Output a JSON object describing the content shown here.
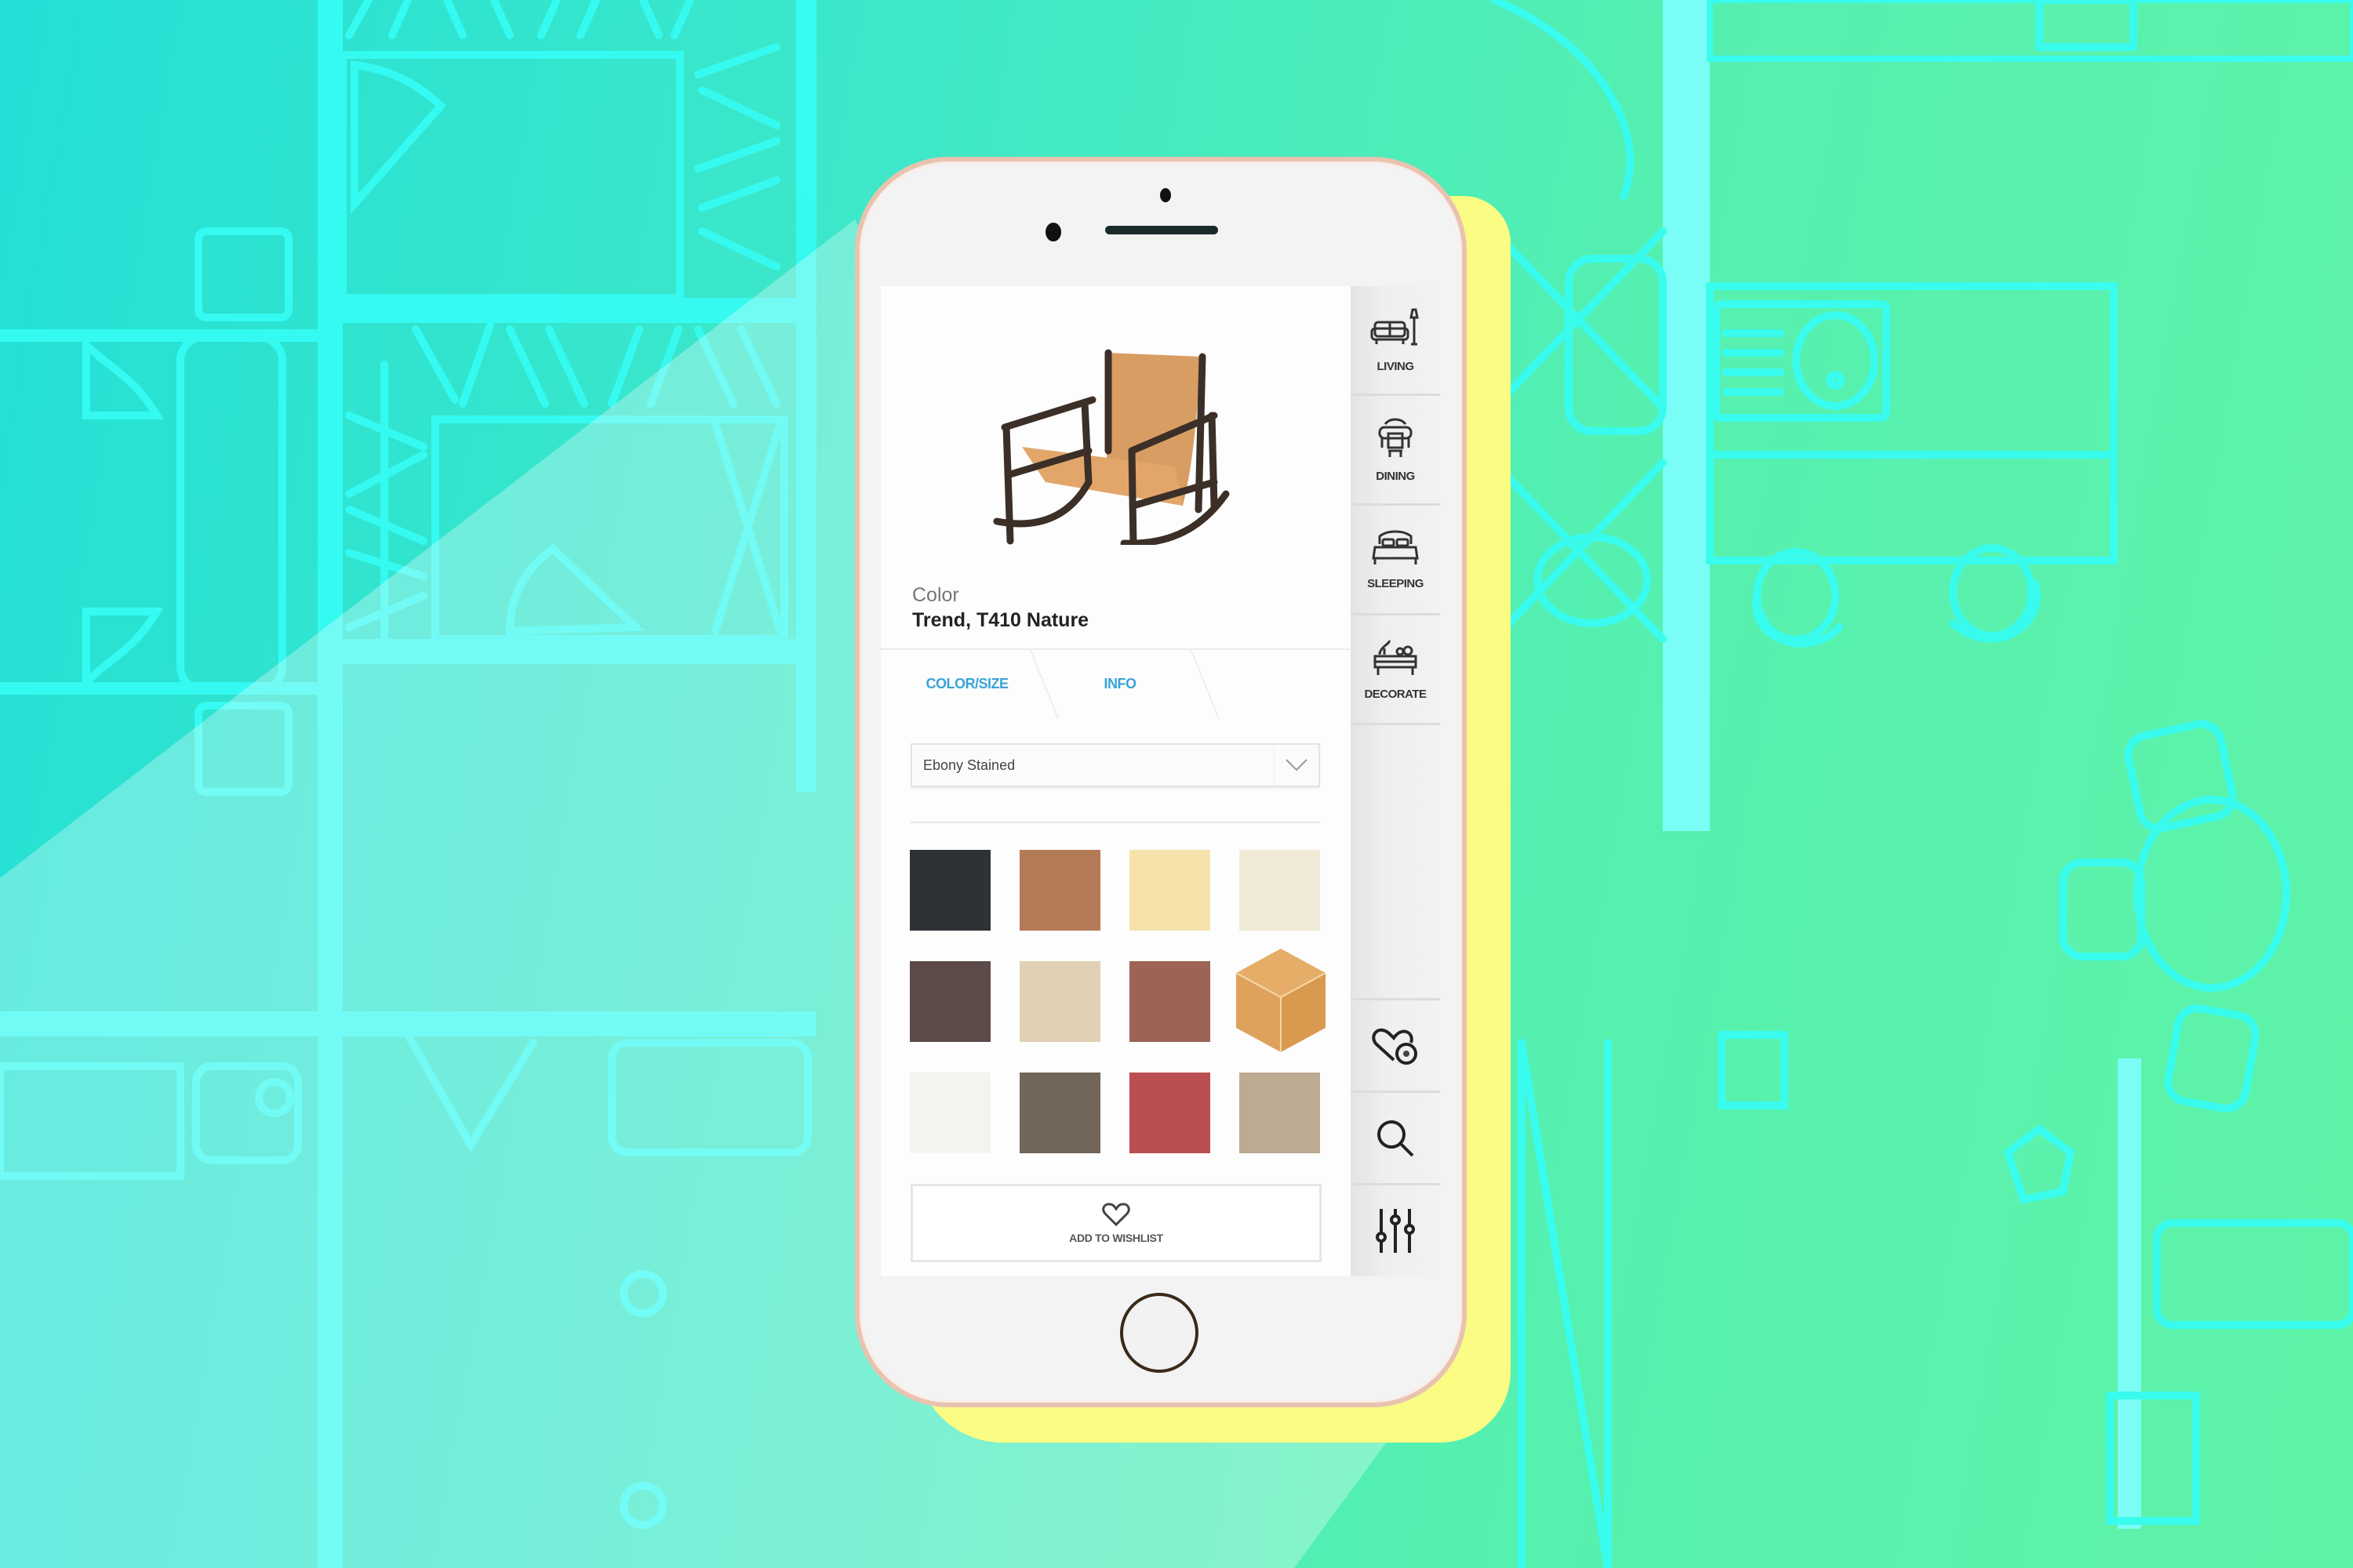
{
  "product": {
    "color_label": "Color",
    "color_value": "Trend, T410 Nature"
  },
  "tabs": [
    {
      "label": "COLOR/SIZE",
      "active": true
    },
    {
      "label": "INFO",
      "active": false
    }
  ],
  "finish_select": {
    "selected": "Ebony Stained"
  },
  "swatches": [
    {
      "name": "charcoal",
      "color": "#2e3236"
    },
    {
      "name": "caramel",
      "color": "#b47a58"
    },
    {
      "name": "butter",
      "color": "#f6e3ac"
    },
    {
      "name": "ivory",
      "color": "#f2ead8"
    },
    {
      "name": "dark-brown",
      "color": "#5d4b4a"
    },
    {
      "name": "sand",
      "color": "#e2d0b4"
    },
    {
      "name": "terracotta",
      "color": "#9c6456"
    },
    {
      "name": "nature-cube",
      "color": "#e2a862",
      "type": "3d-view"
    },
    {
      "name": "off-white",
      "color": "#f4f3ef"
    },
    {
      "name": "taupe",
      "color": "#72655a"
    },
    {
      "name": "red",
      "color": "#bb4e52"
    },
    {
      "name": "khaki",
      "color": "#bcab92"
    }
  ],
  "wishlist": {
    "label": "ADD TO WISHLIST",
    "icon": "heart-icon"
  },
  "sidebar": {
    "categories": [
      {
        "label": "LIVING",
        "icon": "sofa-lamp-icon"
      },
      {
        "label": "DINING",
        "icon": "dining-table-icon"
      },
      {
        "label": "SLEEPING",
        "icon": "bed-icon"
      },
      {
        "label": "DECORATE",
        "icon": "sideboard-decor-icon"
      }
    ],
    "tools": [
      {
        "icon": "wishlist-heart-badge-icon"
      },
      {
        "icon": "search-icon"
      },
      {
        "icon": "filter-sliders-icon"
      }
    ]
  },
  "colors": {
    "accent_tab": "#3aa3d6",
    "background_start": "#22e0d6",
    "background_end": "#5ef3a8",
    "plan_lines": "#7dfff0",
    "shadow_yellow": "#fafc84",
    "phone_edge": "#e8c3b0"
  }
}
